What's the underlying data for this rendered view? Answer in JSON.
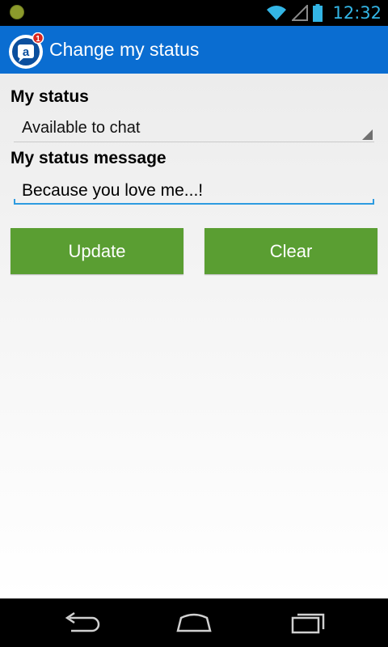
{
  "status_bar": {
    "time": "12:32",
    "icons": [
      "notification-dot-icon",
      "wifi-icon",
      "signal-icon",
      "battery-icon"
    ],
    "accent_color": "#33b5e5"
  },
  "action_bar": {
    "title": "Change my status",
    "badge_count": "1",
    "icon_letter": "a",
    "color": "#0a6dd1"
  },
  "form": {
    "status_label": "My status",
    "status_selected": "Available to chat",
    "message_label": "My status message",
    "message_value": "Because you love me...!"
  },
  "buttons": {
    "update_label": "Update",
    "clear_label": "Clear",
    "color": "#5a9e32"
  },
  "nav": {
    "icons": [
      "back-icon",
      "home-icon",
      "recent-apps-icon"
    ]
  }
}
